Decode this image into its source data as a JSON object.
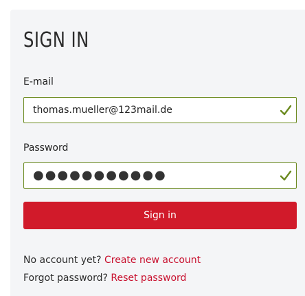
{
  "form": {
    "title": "SIGN IN",
    "email_label": "E-mail",
    "email_value": "thomas.mueller@123mail.de",
    "password_label": "Password",
    "password_mask": "●●●●●●●●●●●",
    "submit_label": "Sign in",
    "valid_icon": "checkmark-icon"
  },
  "links": {
    "no_account_text": "No account yet?",
    "create_account_link": "Create new account",
    "forgot_text": "Forgot password?",
    "reset_link": "Reset password"
  },
  "colors": {
    "accent": "#d11a2a",
    "link": "#c8102e",
    "valid": "#6b8a1f",
    "panel_bg": "#f4f5f7"
  }
}
